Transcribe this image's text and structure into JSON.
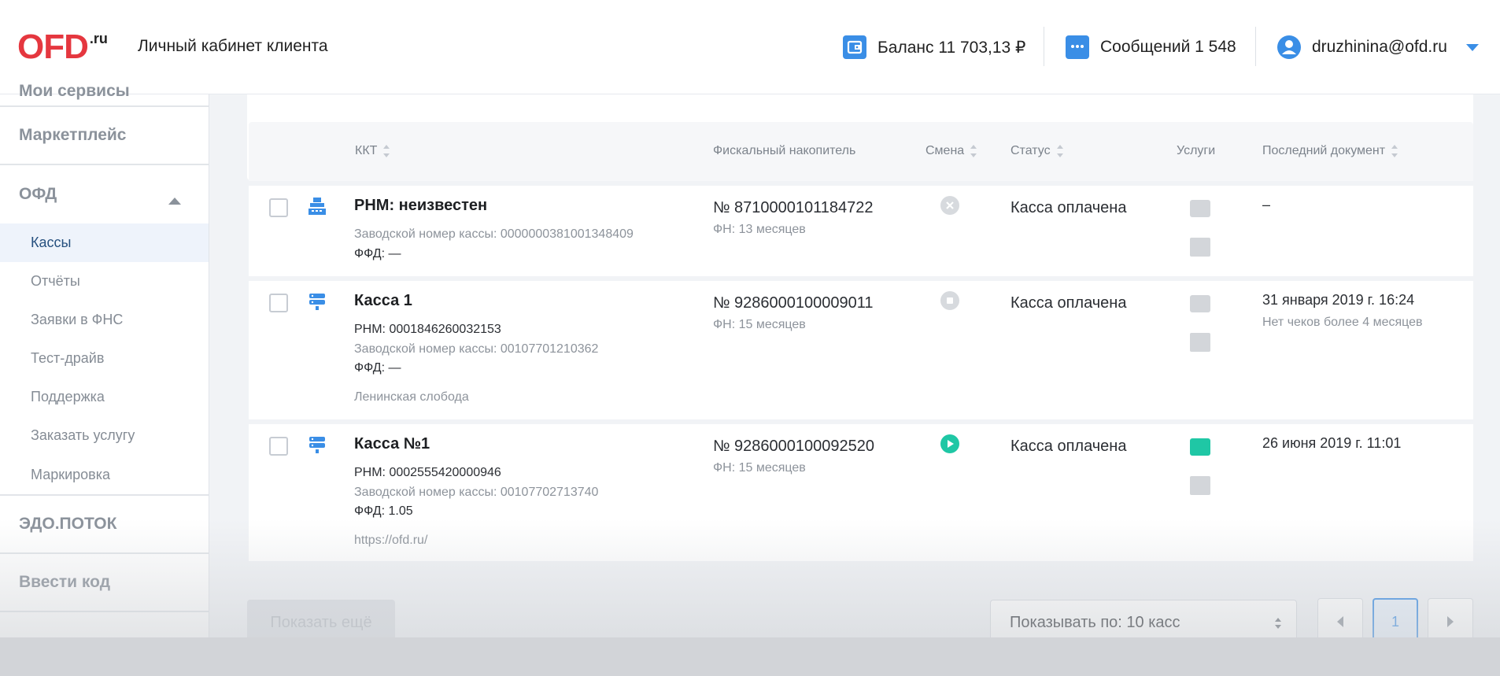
{
  "header": {
    "logo_main": "OFD",
    "logo_suffix": ".ru",
    "cabinet_title": "Личный кабинет клиента",
    "balance": "Баланс 11 703,13 ₽",
    "messages": "Сообщений 1 548",
    "user_email": "druzhinina@ofd.ru"
  },
  "sidebar": {
    "sections": {
      "my_services": "Мои сервисы",
      "marketplace": "Маркетплейс",
      "ofd": "ОФД",
      "edo": "ЭДО.ПОТОК",
      "enter_code": "Ввести код"
    },
    "items": [
      {
        "label": "Кассы",
        "active": true
      },
      {
        "label": "Отчёты"
      },
      {
        "label": "Заявки в ФНС"
      },
      {
        "label": "Тест-драйв"
      },
      {
        "label": "Поддержка"
      },
      {
        "label": "Заказать услугу"
      },
      {
        "label": "Маркировка"
      }
    ]
  },
  "table": {
    "headers": {
      "kkt": "ККТ",
      "fn": "Фискальный накопитель",
      "shift": "Смена",
      "status": "Статус",
      "services": "Услуги",
      "last_doc": "Последний документ"
    },
    "rows": [
      {
        "name": "РНМ: неизвестен",
        "line1": "Заводской номер кассы: 0000000381001348409",
        "line2": "ФФД: —",
        "fn_number": "№ 8710000101184722",
        "fn_period": "ФН: 13 месяцев",
        "shift_state": "closed-x",
        "status": "Касса оплачена",
        "last_doc": "–",
        "last_doc_note": ""
      },
      {
        "name": "Касса 1",
        "line1": "РНМ: 0001846260032153",
        "line2": "Заводской номер кассы: 00107701210362",
        "line3": "ФФД: —",
        "address": "Ленинская слобода",
        "fn_number": "№ 9286000100009011",
        "fn_period": "ФН: 15 месяцев",
        "shift_state": "stopped",
        "status": "Касса оплачена",
        "last_doc": "31 января 2019 г. 16:24",
        "last_doc_note": "Нет чеков более 4 месяцев"
      },
      {
        "name": "Касса №1",
        "line1": "РНМ: 0002555420000946",
        "line2": "Заводской номер кассы: 00107702713740",
        "line3": "ФФД: 1.05",
        "address": "https://ofd.ru/",
        "fn_number": "№ 9286000100092520",
        "fn_period": "ФН: 15 месяцев",
        "shift_state": "open",
        "status": "Касса оплачена",
        "last_doc": "26 июня 2019 г. 11:01",
        "last_doc_note": ""
      }
    ]
  },
  "footer": {
    "show_more": "Показать ещё",
    "per_page": "Показывать по: 10 касс",
    "current_page": "1"
  },
  "colors": {
    "brand_red": "#e5373f",
    "accent_blue": "#3a8ee6",
    "shift_open_green": "#1fc7a5"
  }
}
